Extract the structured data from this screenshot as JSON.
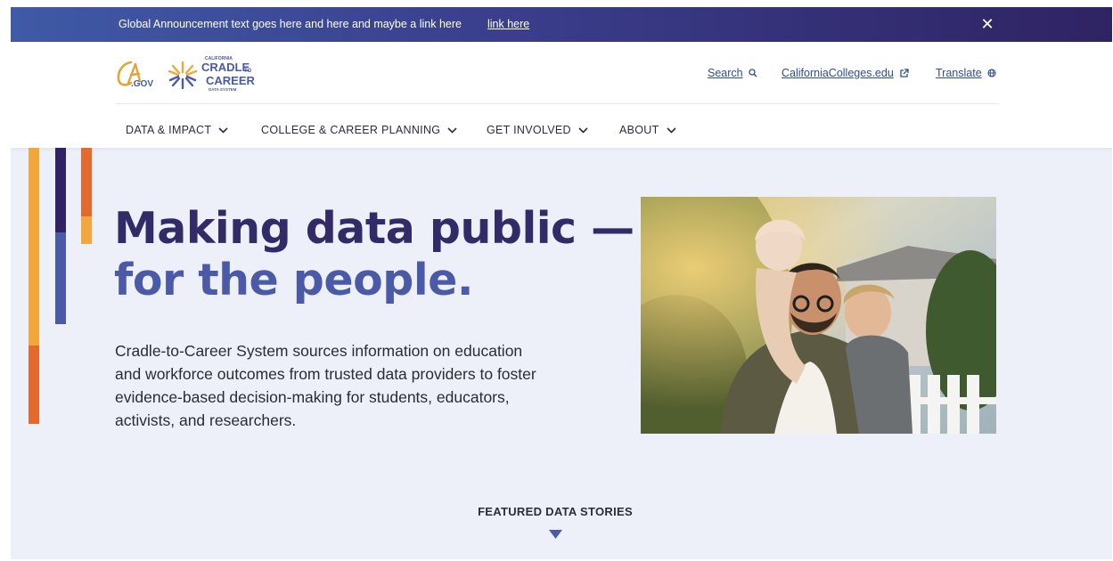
{
  "announcement": {
    "text": "Global Announcement text goes here and here and maybe a link here",
    "link": "link here",
    "close_icon": "close-icon"
  },
  "header": {
    "logo_ca_text": ".GOV",
    "logo_c2c": {
      "line1": "CALIFORNIA",
      "line2": "CRADLE",
      "line3": "TO",
      "line4": "CAREER",
      "line5": "DATA SYSTEM"
    },
    "utility": [
      {
        "label": "Search",
        "icon": "search-icon"
      },
      {
        "label": "CaliforniaColleges.edu",
        "icon": "external-link-icon"
      },
      {
        "label": "Translate",
        "icon": "globe-icon"
      }
    ],
    "nav": [
      {
        "label": "DATA & IMPACT"
      },
      {
        "label": "COLLEGE & CAREER PLANNING"
      },
      {
        "label": "GET INVOLVED"
      },
      {
        "label": "ABOUT"
      }
    ]
  },
  "hero": {
    "headline_line1": "Making data public —",
    "headline_line2": "for the people.",
    "body": "Cradle-to-Career System sources information on education and workforce outcomes from trusted data providers to foster evidence-based decision-making for students, educators, activists, and researchers."
  },
  "featured": {
    "label": "FEATURED DATA STORIES"
  },
  "colors": {
    "navy": "#312b67",
    "blue": "#4b5aa6",
    "orange": "#e4692f",
    "gold": "#f2a73b",
    "link": "#2d4aa0",
    "background": "#eef0f9"
  }
}
